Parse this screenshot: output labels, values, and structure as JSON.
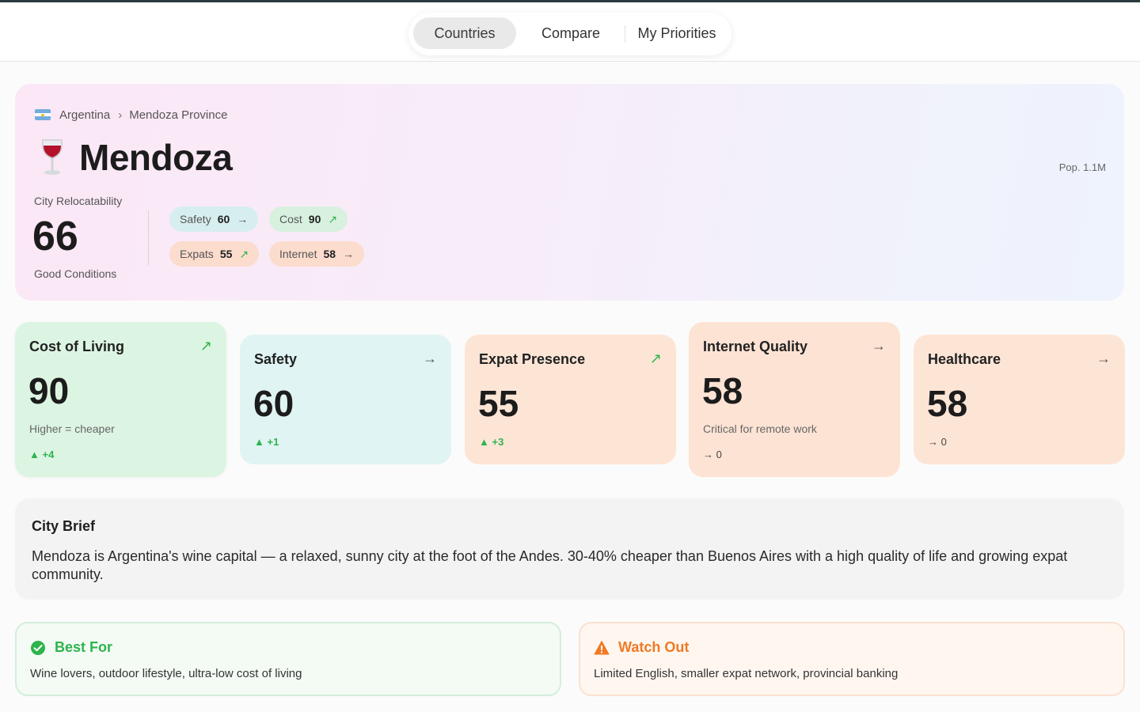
{
  "nav": {
    "tabs": [
      {
        "label": "Countries",
        "active": true
      },
      {
        "label": "Compare",
        "active": false
      },
      {
        "label": "My Priorities",
        "active": false
      }
    ]
  },
  "hero": {
    "breadcrumb": {
      "country": "Argentina",
      "region": "Mendoza Province"
    },
    "city_name": "Mendoza",
    "population": "Pop. 1.1M",
    "relocatability_label": "City Relocatability",
    "relocatability_score": "66",
    "condition": "Good Conditions",
    "chips": [
      {
        "label": "Safety",
        "value": "60",
        "trend": "flat"
      },
      {
        "label": "Cost",
        "value": "90",
        "trend": "up"
      },
      {
        "label": "Expats",
        "value": "55",
        "trend": "up"
      },
      {
        "label": "Internet",
        "value": "58",
        "trend": "flat"
      }
    ]
  },
  "metrics": [
    {
      "title": "Cost of Living",
      "value": "90",
      "subtitle": "Higher = cheaper",
      "delta": "+4",
      "trend": "up"
    },
    {
      "title": "Safety",
      "value": "60",
      "subtitle": "",
      "delta": "+1",
      "trend": "flat"
    },
    {
      "title": "Expat Presence",
      "value": "55",
      "subtitle": "",
      "delta": "+3",
      "trend": "up"
    },
    {
      "title": "Internet Quality",
      "value": "58",
      "subtitle": "Critical for remote work",
      "delta": "0",
      "trend": "flat"
    },
    {
      "title": "Healthcare",
      "value": "58",
      "subtitle": "",
      "delta": "0",
      "trend": "flat"
    }
  ],
  "brief": {
    "title": "City Brief",
    "text": "Mendoza is Argentina's wine capital — a relaxed, sunny city at the foot of the Andes. 30-40% cheaper than Buenos Aires with a high quality of life and growing expat community."
  },
  "best_for": {
    "title": "Best For",
    "text": "Wine lovers, outdoor lifestyle, ultra-low cost of living"
  },
  "watch_out": {
    "title": "Watch Out",
    "text": "Limited English, smaller expat network, provincial banking"
  },
  "colors": {
    "green": "#2eb44e",
    "orange": "#f07a24",
    "argentina_blue": "#74acdf"
  }
}
